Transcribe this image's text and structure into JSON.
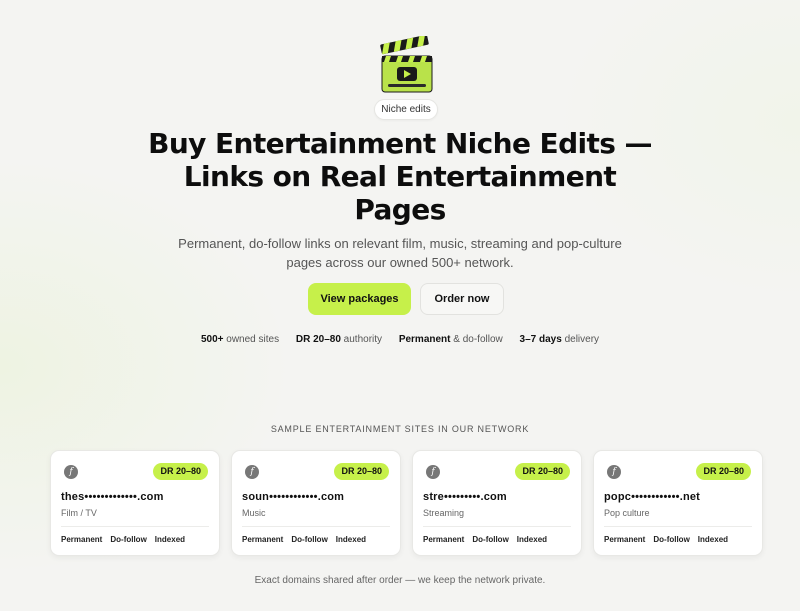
{
  "hero": {
    "badge": "Niche edits",
    "title": "Buy Entertainment Niche Edits — Links on Real Entertainment Pages",
    "subtitle": "Permanent, do-follow links on relevant film, music, streaming and pop-culture pages across our owned 500+ network.",
    "icon": "clapperboard-icon",
    "accent_color": "#c6f04a"
  },
  "actions": {
    "primary_label": "View packages",
    "secondary_label": "Order now"
  },
  "stats": [
    {
      "value": "500+",
      "label": "owned sites"
    },
    {
      "value": "DR 20–80",
      "label": "authority"
    },
    {
      "value": "Permanent",
      "label": "& do-follow"
    },
    {
      "value": "3–7 days",
      "label": "delivery"
    }
  ],
  "samples": {
    "heading": "SAMPLE ENTERTAINMENT SITES IN OUR NETWORK",
    "cards": [
      {
        "logo": "f",
        "dr": "DR 20–80",
        "domain": "thes•••••••••••••.com",
        "category": "Film / TV",
        "tags": [
          "Permanent",
          "Do-follow",
          "Indexed"
        ]
      },
      {
        "logo": "f",
        "dr": "DR 20–80",
        "domain": "soun••••••••••••.com",
        "category": "Music",
        "tags": [
          "Permanent",
          "Do-follow",
          "Indexed"
        ]
      },
      {
        "logo": "f",
        "dr": "DR 20–80",
        "domain": "stre•••••••••.com",
        "category": "Streaming",
        "tags": [
          "Permanent",
          "Do-follow",
          "Indexed"
        ]
      },
      {
        "logo": "f",
        "dr": "DR 20–80",
        "domain": "popc••••••••••••.net",
        "category": "Pop culture",
        "tags": [
          "Permanent",
          "Do-follow",
          "Indexed"
        ]
      }
    ],
    "footnote": "Exact domains shared after order — we keep the network private."
  }
}
